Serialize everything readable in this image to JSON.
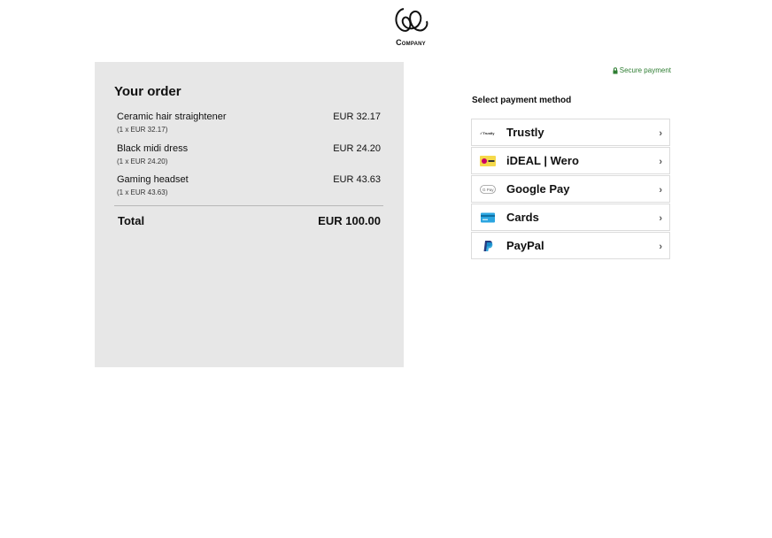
{
  "brand": {
    "name": "Company"
  },
  "order": {
    "title": "Your order",
    "items": [
      {
        "name": "Ceramic hair straightener",
        "price": "EUR 32.17",
        "qty": "(1 x EUR 32.17)"
      },
      {
        "name": "Black midi dress",
        "price": "EUR 24.20",
        "qty": "(1 x EUR 24.20)"
      },
      {
        "name": "Gaming headset",
        "price": "EUR 43.63",
        "qty": "(1 x EUR 43.63)"
      }
    ],
    "total_label": "Total",
    "total_value": "EUR 100.00"
  },
  "payment": {
    "secure_label": "Secure payment",
    "select_title": "Select payment method",
    "methods": [
      {
        "name": "Trustly",
        "icon": "trustly-icon"
      },
      {
        "name": "iDEAL | Wero",
        "icon": "ideal-wero-icon"
      },
      {
        "name": "Google Pay",
        "icon": "google-pay-icon"
      },
      {
        "name": "Cards",
        "icon": "card-icon"
      },
      {
        "name": "PayPal",
        "icon": "paypal-icon"
      }
    ]
  },
  "colors": {
    "panel": "#e7e7e7",
    "secure": "#2e7d32",
    "border": "#dcdcdc"
  }
}
